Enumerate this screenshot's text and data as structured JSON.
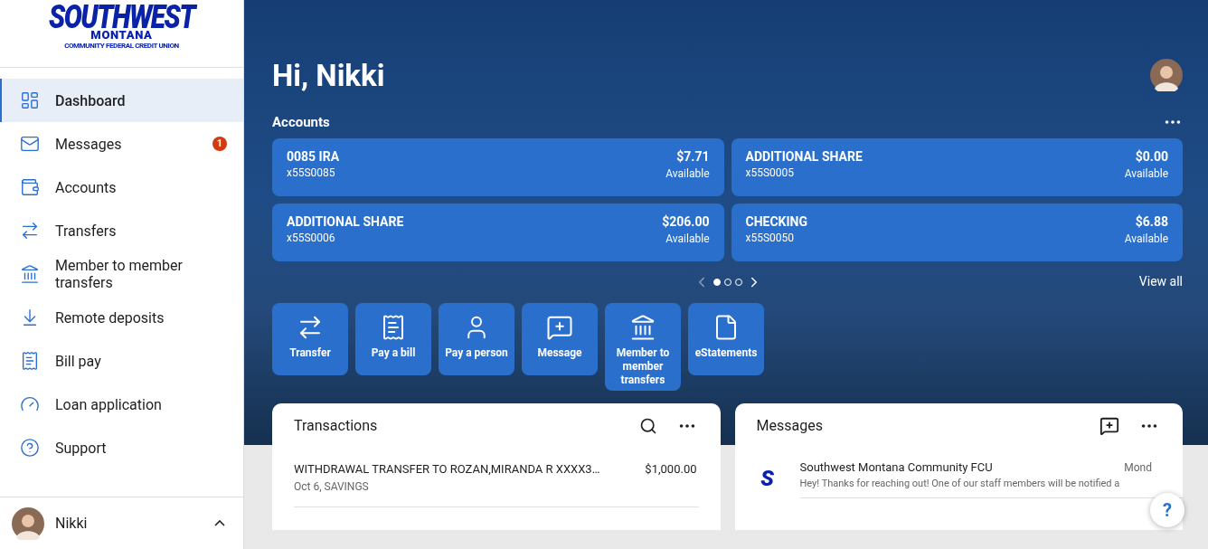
{
  "logo": {
    "line_1": "SOUTHWEST",
    "line_2": "MONTANA",
    "line_3": "COMMUNITY FEDERAL CREDIT UNION"
  },
  "sidebar": {
    "items": [
      {
        "label": "Dashboard",
        "selected": true
      },
      {
        "label": "Messages",
        "selected": false,
        "badge": "1"
      },
      {
        "label": "Accounts",
        "selected": false
      },
      {
        "label": "Transfers",
        "selected": false
      },
      {
        "label": "Member to member transfers",
        "selected": false
      },
      {
        "label": "Remote deposits",
        "selected": false
      },
      {
        "label": "Bill pay",
        "selected": false
      },
      {
        "label": "Loan application",
        "selected": false
      },
      {
        "label": "Support",
        "selected": false
      }
    ],
    "user": {
      "name": "Nikki",
      "expanded": true
    }
  },
  "greeting": "Hi, Nikki",
  "accounts": {
    "title": "Accounts",
    "cards": [
      {
        "name": "0085 IRA",
        "number": "x55S0085",
        "balance": "$7.71",
        "balance_label": "Available"
      },
      {
        "name": "ADDITIONAL SHARE",
        "number": "x55S0005",
        "balance": "$0.00",
        "balance_label": "Available"
      },
      {
        "name": "ADDITIONAL SHARE",
        "number": "x55S0006",
        "balance": "$206.00",
        "balance_label": "Available"
      },
      {
        "name": "CHECKING",
        "number": "x55S0050",
        "balance": "$6.88",
        "balance_label": "Available"
      }
    ],
    "pages": [
      {
        "selected": true
      },
      {
        "selected": false
      },
      {
        "selected": false
      }
    ],
    "view_all": "View all"
  },
  "actions": [
    "Transfer",
    "Pay a bill",
    "Pay a person",
    "Message",
    "Member to member transfers",
    "eStatements"
  ],
  "transactions": {
    "title": "Transactions",
    "rows": [
      {
        "description": "WITHDRAWAL TRANSFER TO ROZAN,MIRANDA R XXXX3…",
        "detail": "Oct 6, SAVINGS",
        "amount": "$1,000.00"
      }
    ]
  },
  "messages": {
    "title": "Messages",
    "rows": [
      {
        "avatar_letter": "S",
        "sender": "Southwest Montana Community FCU",
        "date": "Mond",
        "preview": "Hey! Thanks for reaching out! One of our staff members will be notified a"
      }
    ]
  },
  "help_button": "?"
}
